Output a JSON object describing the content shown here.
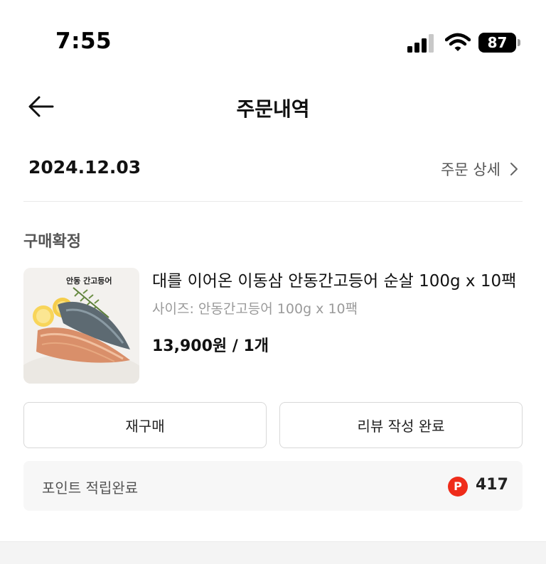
{
  "status_bar": {
    "time": "7:55",
    "battery": "87"
  },
  "nav": {
    "title": "주문내역"
  },
  "order": {
    "date": "2024.12.03",
    "detail_link": "주문 상세",
    "status": "구매확정",
    "product": {
      "name": "대를 이어온 이동삼 안동간고등어 순살 100g x 10팩",
      "option": "사이즈: 안동간고등어 100g x 10팩",
      "price_qty": "13,900원 / 1개",
      "thumb_brand": "안동 간고등어"
    },
    "buttons": {
      "rebuy": "재구매",
      "review": "리뷰 작성 완료"
    },
    "points": {
      "label": "포인트 적립완료",
      "badge": "P",
      "value": "417"
    }
  },
  "colors": {
    "point_badge": "#ef2c1a",
    "muted_text": "#9a9a9a"
  }
}
